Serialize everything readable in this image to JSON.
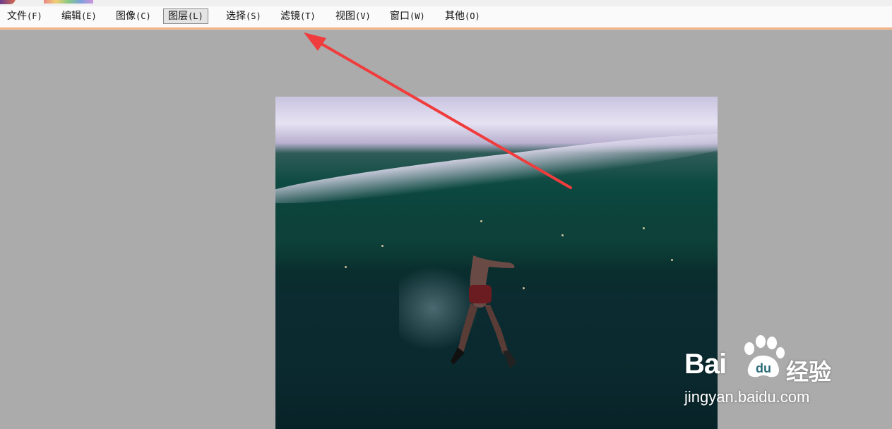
{
  "menubar": {
    "items": [
      {
        "label": "文件",
        "hotkey": "(F)"
      },
      {
        "label": "编辑",
        "hotkey": "(E)"
      },
      {
        "label": "图像",
        "hotkey": "(C)"
      },
      {
        "label": "图层",
        "hotkey": "(L)"
      },
      {
        "label": "选择",
        "hotkey": "(S)"
      },
      {
        "label": "滤镜",
        "hotkey": "(T)"
      },
      {
        "label": "视图",
        "hotkey": "(V)"
      },
      {
        "label": "窗口",
        "hotkey": "(W)"
      },
      {
        "label": "其他",
        "hotkey": "(O)"
      }
    ],
    "active_item": "图层",
    "accent_color": "#f2a068"
  },
  "canvas": {
    "background_color": "#ababab",
    "image_subject": "underwater-swimmer-photo"
  },
  "annotation": {
    "type": "red-arrow",
    "color": "#f03c3c",
    "points_to": "滤镜"
  },
  "watermark": {
    "brand": "Bai",
    "brand_cn": "经验",
    "url": "jingyan.baidu.com"
  }
}
